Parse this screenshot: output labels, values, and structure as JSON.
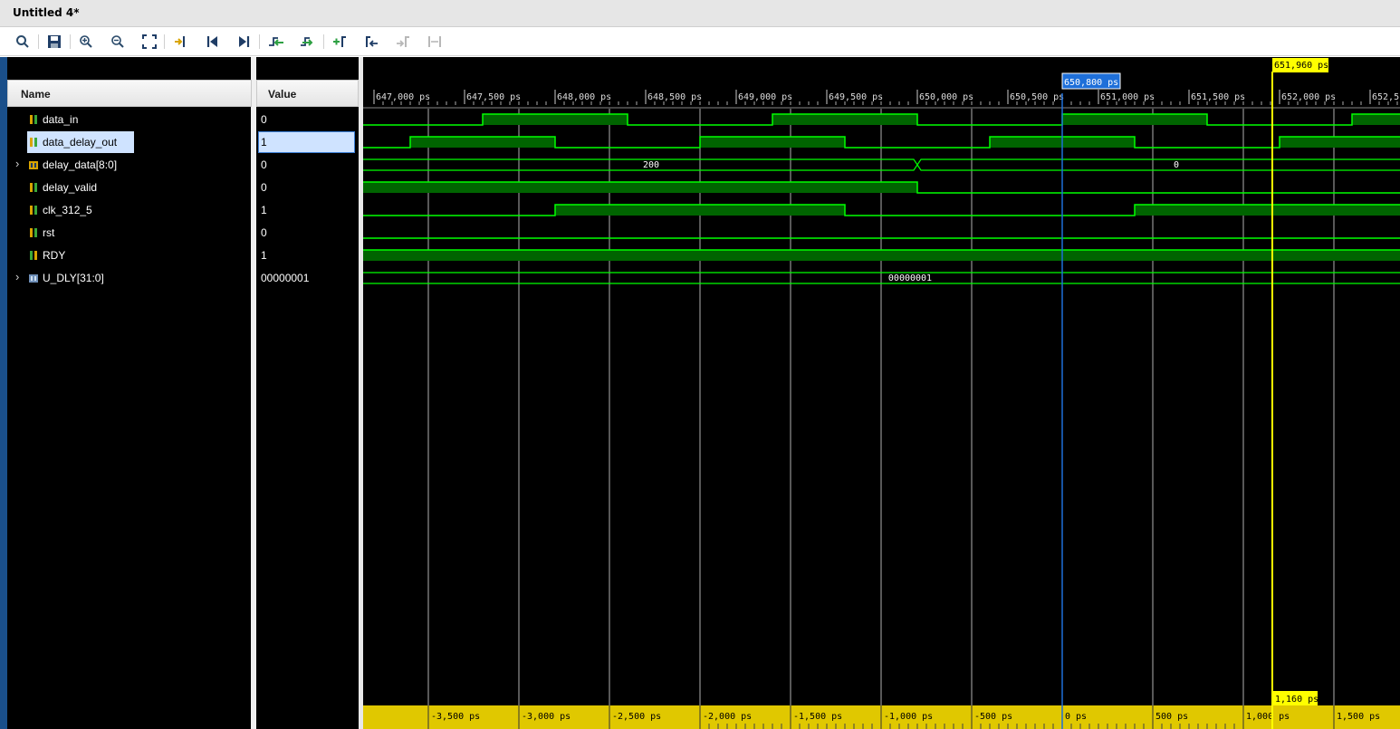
{
  "window": {
    "title": "Untitled 4*"
  },
  "toolbar": {
    "buttons": [
      "search-icon",
      "save-icon",
      "zoom-in-icon",
      "zoom-out-icon",
      "zoom-fit-icon",
      "go-to-cursor-icon",
      "go-to-time-zero-icon",
      "go-to-last-time-icon",
      "previous-transition-icon",
      "next-transition-icon",
      "add-marker-icon",
      "previous-marker-icon",
      "next-marker-icon",
      "swap-cursors-icon"
    ]
  },
  "columns": {
    "name": "Name",
    "value": "Value"
  },
  "signals": [
    {
      "name": "data_in",
      "value": "0",
      "expandable": false,
      "icon": "wire-icon"
    },
    {
      "name": "data_delay_out",
      "value": "1",
      "expandable": false,
      "icon": "wire-icon",
      "selected": true
    },
    {
      "name": "delay_data[8:0]",
      "value": "0",
      "expandable": true,
      "icon": "bus-icon"
    },
    {
      "name": "delay_valid",
      "value": "0",
      "expandable": false,
      "icon": "wire-icon"
    },
    {
      "name": "clk_312_5",
      "value": "1",
      "expandable": false,
      "icon": "wire-icon"
    },
    {
      "name": "rst",
      "value": "0",
      "expandable": false,
      "icon": "wire-icon"
    },
    {
      "name": "RDY",
      "value": "1",
      "expandable": false,
      "icon": "output-wire-icon"
    },
    {
      "name": "U_DLY[31:0]",
      "value": "00000001",
      "expandable": true,
      "icon": "bus-param-icon"
    }
  ],
  "timeline": {
    "top_labels": [
      "647,000 ps",
      "647,500 ps",
      "648,000 ps",
      "648,500 ps",
      "649,000 ps",
      "649,500 ps",
      "650,000 ps",
      "650,500 ps",
      "651,000 ps",
      "651,500 ps",
      "652,000 ps",
      "652,5"
    ],
    "bottom_labels": [
      "-3,500 ps",
      "-3,000 ps",
      "-2,500 ps",
      "-2,000 ps",
      "-1,500 ps",
      "-1,000 ps",
      "-500 ps",
      "0 ps",
      "500 ps",
      "1,000 ps",
      "1,500 ps"
    ],
    "cursor_blue_label": "650,800 ps",
    "cursor_yellow_label": "651,960 ps",
    "delta_label": "1,160 ps",
    "bus_values": {
      "delay_data_left": "200",
      "delay_data_right": "0",
      "u_dly": "00000001"
    }
  },
  "colors": {
    "wave_high_fill": "#006400",
    "wave_line": "#00ff00",
    "cursor_blue": "#1e6fd9",
    "cursor_yellow": "#ffff00",
    "ruler_yellow": "#e0c800"
  }
}
